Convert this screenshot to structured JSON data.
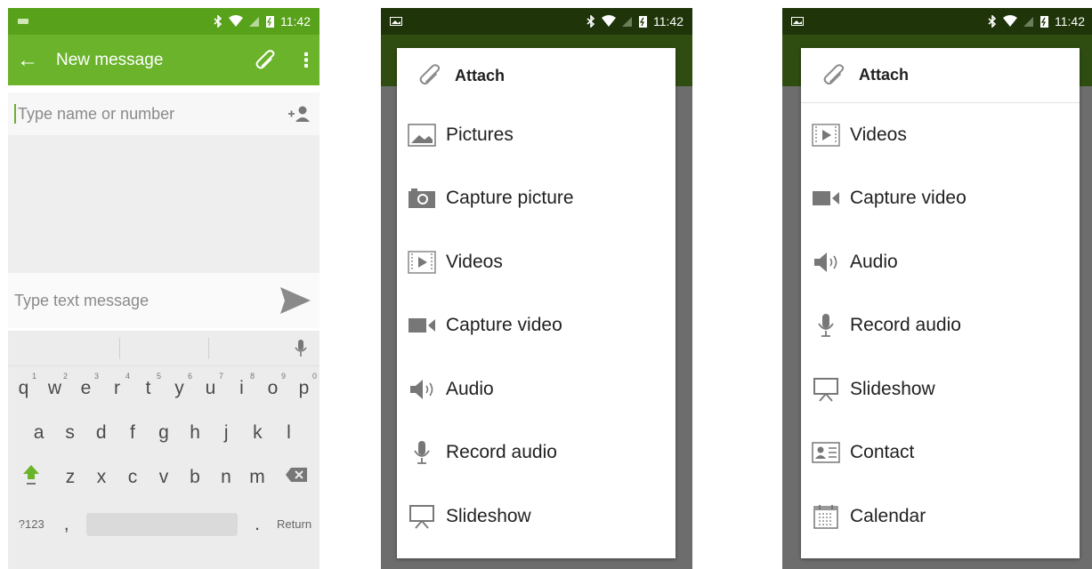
{
  "status_bar": {
    "time": "11:42"
  },
  "screen1": {
    "appbar": {
      "back_icon": "arrow-back-icon",
      "title": "New message",
      "attach_icon": "paperclip-icon",
      "menu_icon": "more-vert-icon"
    },
    "recipient": {
      "placeholder": "Type name or number",
      "add_icon": "add-contact-icon"
    },
    "compose": {
      "placeholder": "Type text message",
      "send_icon": "send-icon"
    },
    "keyboard": {
      "row1": [
        {
          "k": "q",
          "n": "1"
        },
        {
          "k": "w",
          "n": "2"
        },
        {
          "k": "e",
          "n": "3"
        },
        {
          "k": "r",
          "n": "4"
        },
        {
          "k": "t",
          "n": "5"
        },
        {
          "k": "y",
          "n": "6"
        },
        {
          "k": "u",
          "n": "7"
        },
        {
          "k": "i",
          "n": "8"
        },
        {
          "k": "o",
          "n": "9"
        },
        {
          "k": "p",
          "n": "0"
        }
      ],
      "row2": [
        "a",
        "s",
        "d",
        "f",
        "g",
        "h",
        "j",
        "k",
        "l"
      ],
      "row3": [
        "z",
        "x",
        "c",
        "v",
        "b",
        "n",
        "m"
      ],
      "symbols_label": "?123",
      "comma": ",",
      "period": ".",
      "return_label": "Return"
    }
  },
  "screen2": {
    "dialog_title": "Attach",
    "items": [
      {
        "label": "Pictures",
        "icon": "picture-icon"
      },
      {
        "label": "Capture picture",
        "icon": "camera-icon"
      },
      {
        "label": "Videos",
        "icon": "video-file-icon"
      },
      {
        "label": "Capture video",
        "icon": "video-camera-icon"
      },
      {
        "label": "Audio",
        "icon": "speaker-icon"
      },
      {
        "label": "Record audio",
        "icon": "microphone-icon"
      },
      {
        "label": "Slideshow",
        "icon": "slideshow-icon"
      }
    ]
  },
  "screen3": {
    "dialog_title": "Attach",
    "items": [
      {
        "label": "Videos",
        "icon": "video-file-icon"
      },
      {
        "label": "Capture video",
        "icon": "video-camera-icon"
      },
      {
        "label": "Audio",
        "icon": "speaker-icon"
      },
      {
        "label": "Record audio",
        "icon": "microphone-icon"
      },
      {
        "label": "Slideshow",
        "icon": "slideshow-icon"
      },
      {
        "label": "Contact",
        "icon": "contact-card-icon"
      },
      {
        "label": "Calendar",
        "icon": "calendar-icon"
      }
    ]
  },
  "colors": {
    "accent": "#6ab32b",
    "status_green": "#58a11b"
  }
}
